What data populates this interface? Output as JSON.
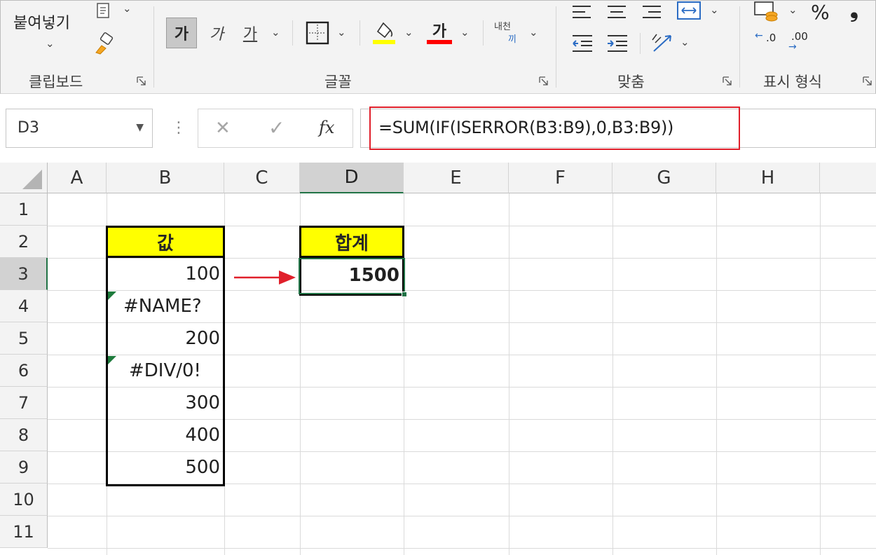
{
  "ribbon": {
    "clipboard": {
      "paste_label": "붙여넣기",
      "group_label": "클립보드"
    },
    "font": {
      "bold_label": "가",
      "italic_label": "가",
      "underline_label": "가",
      "font_color_label": "가",
      "phonetic_top": "내천",
      "phonetic_bottom": "끼",
      "group_label": "글꼴",
      "fill_color": "#ffff00",
      "text_color": "#ff0000"
    },
    "alignment": {
      "group_label": "맞춤"
    },
    "number": {
      "percent_label": "%",
      "comma_label": "❟",
      "inc_decimal_label": ".0",
      "dec_decimal_label": ".00",
      "group_label": "표시 형식"
    }
  },
  "formula_bar": {
    "name_box": "D3",
    "cancel_symbol": "✕",
    "enter_symbol": "✓",
    "fx_label": "fx",
    "formula": "=SUM(IF(ISERROR(B3:B9),0,B3:B9))",
    "highlight_color": "#e0202b"
  },
  "sheet": {
    "columns": [
      "A",
      "B",
      "C",
      "D",
      "E",
      "F",
      "G",
      "H"
    ],
    "rows": [
      "1",
      "2",
      "3",
      "4",
      "5",
      "6",
      "7",
      "8",
      "9",
      "10",
      "11"
    ],
    "selected_column": "D",
    "selected_row": "3",
    "cells": {
      "B2": "값",
      "B3": "100",
      "B4": "#NAME?",
      "B5": "200",
      "B6": "#DIV/0!",
      "B7": "300",
      "B8": "400",
      "B9": "500",
      "D2": "합계",
      "D3": "1500"
    },
    "header_fill": "#ffff00",
    "selection_color": "#217346",
    "arrow_color": "#e0202b"
  }
}
